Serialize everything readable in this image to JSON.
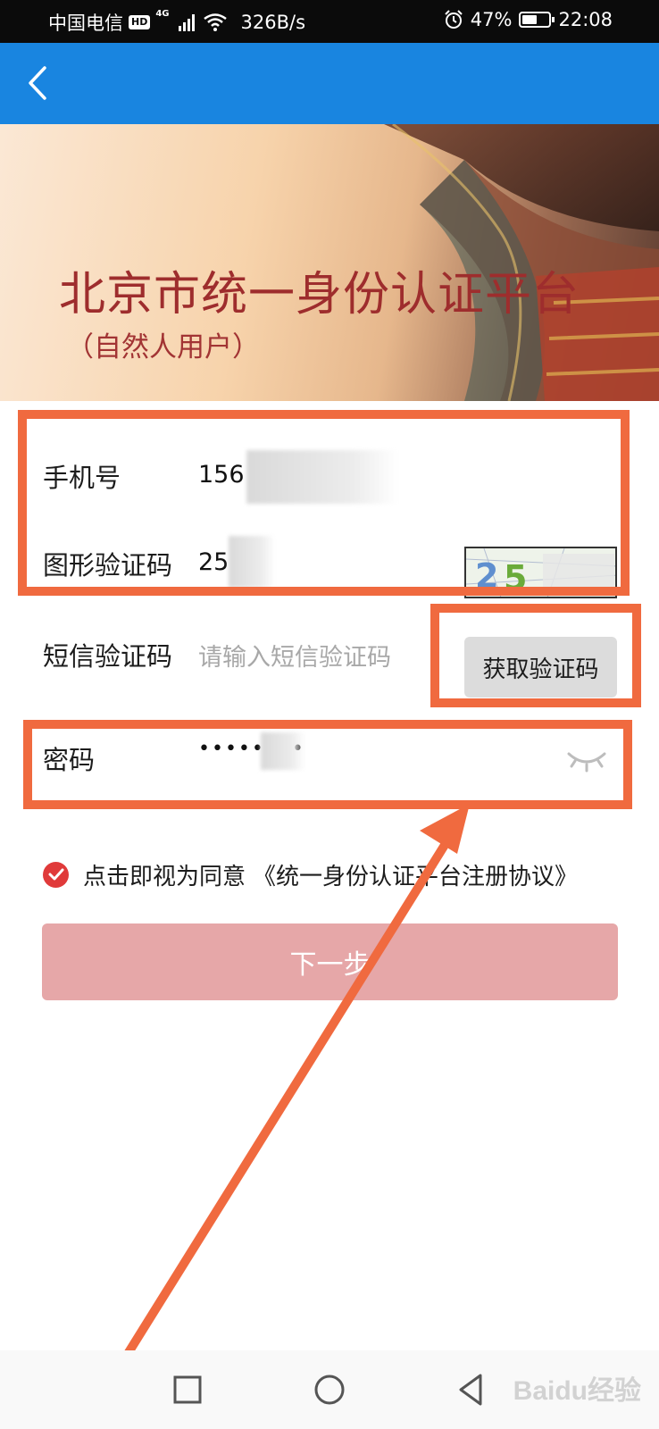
{
  "status_bar": {
    "carrier": "中国电信",
    "hd_badge": "HD",
    "network_type": "4G",
    "speed": "326B/s",
    "battery_percent": "47%",
    "battery_level": 0.47,
    "time": "22:08"
  },
  "banner": {
    "title": "北京市统一身份认证平台",
    "subtitle": "（自然人用户）"
  },
  "form": {
    "phone": {
      "label": "手机号",
      "value": "156"
    },
    "image_captcha": {
      "label": "图形验证码",
      "value": "25",
      "captcha_text": "25"
    },
    "sms_code": {
      "label": "短信验证码",
      "placeholder": "请输入短信验证码",
      "button_label": "获取验证码"
    },
    "password": {
      "label": "密码",
      "value": "••••••••"
    }
  },
  "agreement": {
    "text": "点击即视为同意",
    "link": "《统一身份认证平台注册协议》",
    "checked": true
  },
  "next_button": {
    "label": "下一步"
  },
  "watermark": "Baidu经验",
  "colors": {
    "app_bar": "#1985e0",
    "annotation": "#f06a3f",
    "next_button": "#e6a7a8",
    "checkbox": "#e03a3a",
    "banner_title": "#9e2d2d"
  }
}
